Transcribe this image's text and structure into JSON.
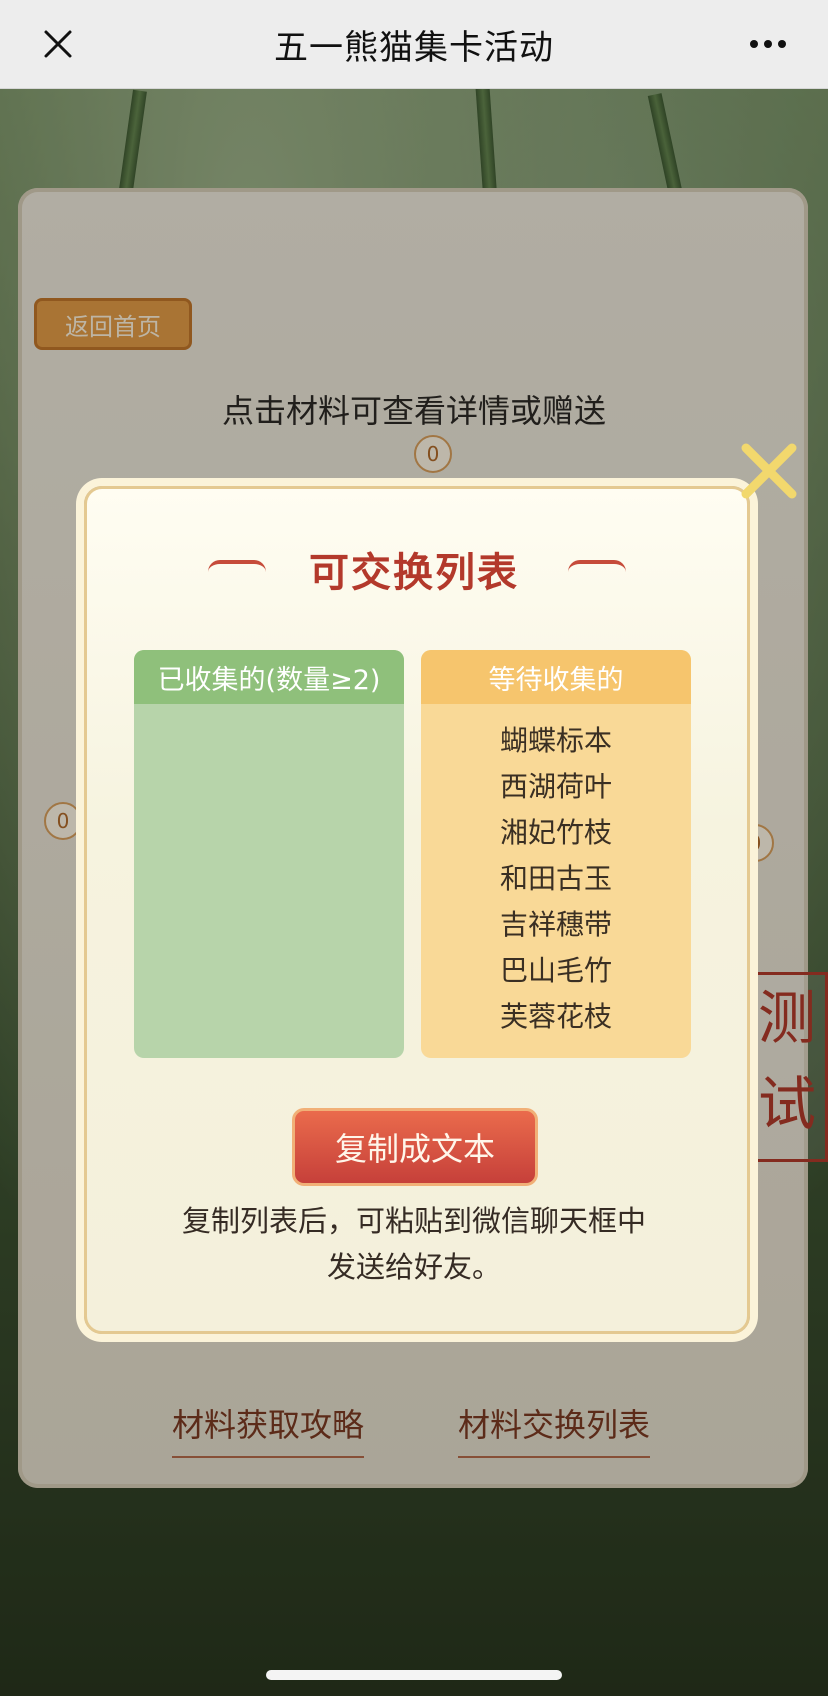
{
  "header": {
    "title": "五一熊猫集卡活动"
  },
  "page": {
    "back_home": "返回首页",
    "hint": "点击材料可查看详情或赠送",
    "counter_zero": "0",
    "bottom_links": [
      "材料获取攻略",
      "材料交换列表"
    ],
    "test_stamp": "测试"
  },
  "modal": {
    "title": "可交换列表",
    "collected_header": "已收集的(数量≥2)",
    "waiting_header": "等待收集的",
    "waiting_items": [
      "蝴蝶标本",
      "西湖荷叶",
      "湘妃竹枝",
      "和田古玉",
      "吉祥穗带",
      "巴山毛竹",
      "芙蓉花枝"
    ],
    "copy_button": "复制成文本",
    "description_line1": "复制列表后，可粘贴到微信聊天框中",
    "description_line2": "发送给好友。"
  },
  "colors": {
    "accent_red": "#b3392b",
    "green_header": "#8fc07b",
    "orange_header": "#f6c56d"
  }
}
